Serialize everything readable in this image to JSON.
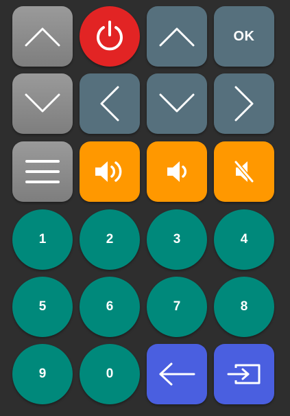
{
  "colors": {
    "background": "#2e2e2e",
    "gray_button": "#8c8c8c",
    "slate_button": "#56707d",
    "power_button": "#e22424",
    "volume_button": "#ff9800",
    "number_button": "#00897b",
    "action_button": "#4a5fe0"
  },
  "buttons": {
    "ch_up_icon": "chevron-up-icon",
    "power_icon": "power-icon",
    "nav_up_icon": "chevron-up-icon",
    "ok_label": "OK",
    "ch_down_icon": "chevron-down-icon",
    "nav_left_icon": "chevron-left-icon",
    "nav_down_icon": "chevron-down-icon",
    "nav_right_icon": "chevron-right-icon",
    "menu_icon": "menu-icon",
    "vol_up_icon": "volume-up-icon",
    "vol_down_icon": "volume-down-icon",
    "mute_icon": "volume-mute-icon",
    "back_icon": "arrow-left-icon",
    "input_icon": "input-source-icon"
  },
  "numbers": [
    "1",
    "2",
    "3",
    "4",
    "5",
    "6",
    "7",
    "8",
    "9",
    "0"
  ]
}
